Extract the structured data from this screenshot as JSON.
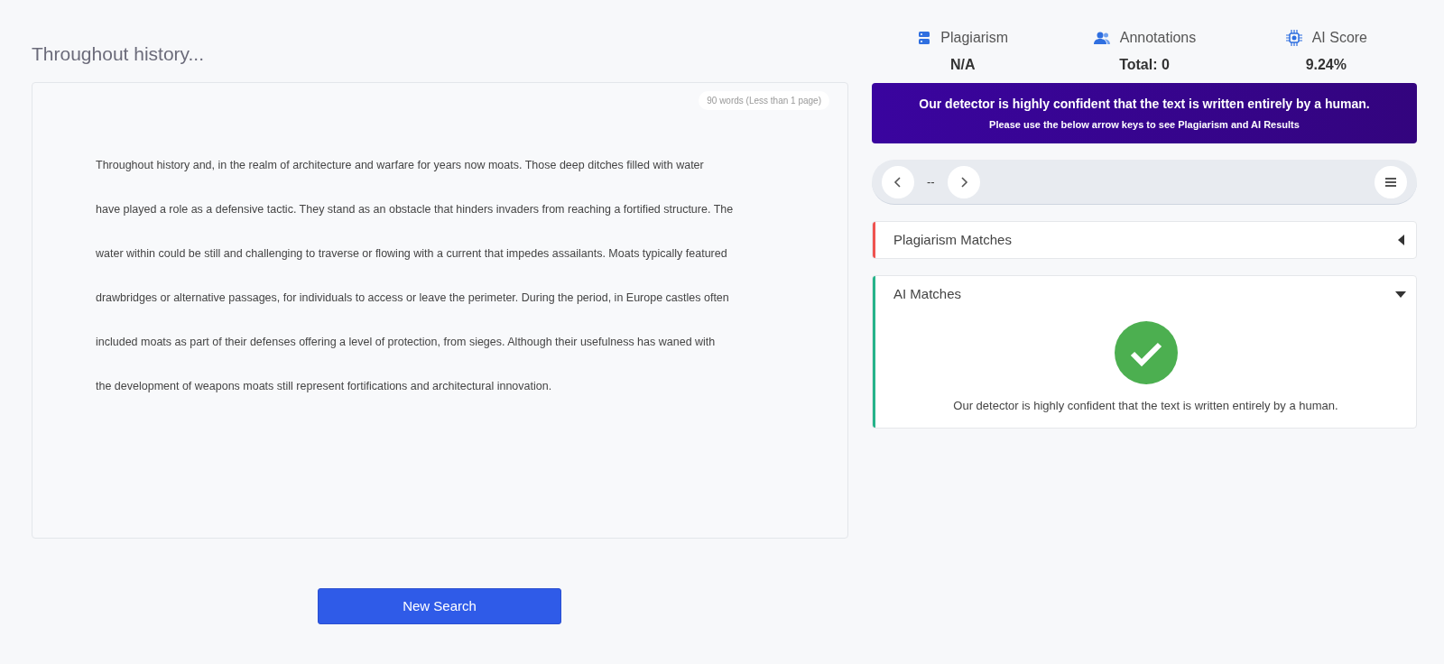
{
  "document": {
    "title": "Throughout history...",
    "word_count": "90 words (Less than 1 page)",
    "lines": [
      "Throughout history and, in the realm of architecture and warfare for years now moats. Those deep ditches filled with water",
      "have played a role as a defensive tactic. They stand as an obstacle that hinders invaders from reaching a fortified structure. The",
      "water within could be still and challenging to traverse or flowing with a current that impedes assailants. Moats typically featured",
      "drawbridges or alternative passages, for individuals to access or leave the perimeter. During the period, in Europe castles often",
      "included moats as part of their defenses offering a level of protection, from sieges. Although their usefulness has waned with",
      "the development of weapons moats still represent fortifications and architectural innovation."
    ]
  },
  "new_search_button": "New Search",
  "stats": [
    {
      "kind": "plagiarism",
      "label": "Plagiarism",
      "value": "N/A"
    },
    {
      "kind": "annotations",
      "label": "Annotations",
      "value": "Total: 0"
    },
    {
      "kind": "ai",
      "label": "AI Score",
      "value": "9.24%"
    }
  ],
  "banner": {
    "headline": "Our detector is highly confident that the text is written entirely by a human.",
    "subline": "Please use the below arrow keys to see Plagiarism and AI Results"
  },
  "navigator": {
    "position": "--"
  },
  "panels": [
    {
      "title": "Plagiarism Matches",
      "expanded": false,
      "color": "#ef5350"
    },
    {
      "title": "AI Matches",
      "expanded": true,
      "color": "#26b38a",
      "message": "Our detector is highly confident that the text is written entirely by a human."
    }
  ]
}
